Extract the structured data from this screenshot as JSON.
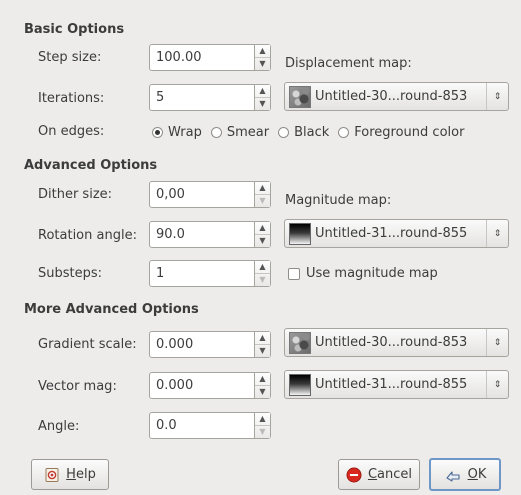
{
  "sections": {
    "basic": "Basic Options",
    "advanced": "Advanced Options",
    "more_advanced": "More Advanced Options"
  },
  "basic": {
    "step_size_label": "Step size:",
    "step_size_value": "100.00",
    "iterations_label": "Iterations:",
    "iterations_value": "5",
    "on_edges_label": "On edges:",
    "edge_options": [
      "Wrap",
      "Smear",
      "Black",
      "Foreground color"
    ],
    "edge_selected": "Wrap",
    "displacement_map_label": "Displacement map:",
    "displacement_map_value": "Untitled-30...round-853"
  },
  "advanced": {
    "dither_size_label": "Dither size:",
    "dither_size_value": "0,00",
    "rotation_angle_label": "Rotation angle:",
    "rotation_angle_value": "90.0",
    "substeps_label": "Substeps:",
    "substeps_value": "1",
    "magnitude_map_label": "Magnitude map:",
    "magnitude_map_value": "Untitled-31...round-855",
    "use_magnitude_map_label": "Use magnitude map",
    "use_magnitude_map_checked": false
  },
  "more_advanced": {
    "gradient_scale_label": "Gradient scale:",
    "gradient_scale_value": "0.000",
    "gradient_map_value": "Untitled-30...round-853",
    "vector_mag_label": "Vector mag:",
    "vector_mag_value": "0.000",
    "vector_map_value": "Untitled-31...round-855",
    "angle_label": "Angle:",
    "angle_value": "0.0"
  },
  "buttons": {
    "help_mnemonic": "H",
    "help_rest": "elp",
    "cancel_mnemonic": "C",
    "cancel_rest": "ancel",
    "ok_mnemonic": "O",
    "ok_rest": "K"
  },
  "icons": {
    "help": "help-book-icon",
    "cancel": "cancel-stop-icon",
    "ok": "ok-hand-icon",
    "spin_up": "up-arrow-icon",
    "spin_down": "down-arrow-icon",
    "combo": "updown-chevron-icon"
  }
}
